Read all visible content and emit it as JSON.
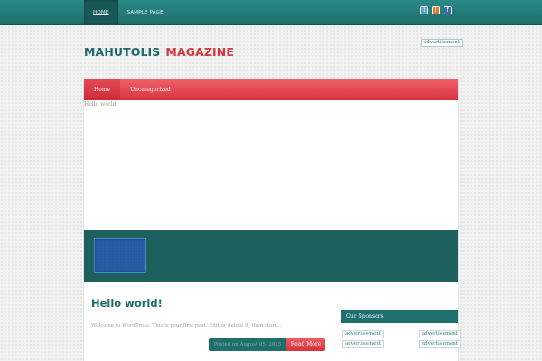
{
  "topnav": {
    "items": [
      "HOME",
      "SAMPLE PAGE"
    ]
  },
  "social": [
    {
      "icon": "twitter-icon",
      "glyph": "t",
      "color": "#4fa3c8"
    },
    {
      "icon": "rss-icon",
      "glyph": ")",
      "color": "#e07a2a"
    },
    {
      "icon": "facebook-icon",
      "glyph": "f",
      "color": "#3b6aa6"
    }
  ],
  "logo": {
    "part1": "MAHUTOLIS",
    "part2": "MAGAZINE"
  },
  "ad_top": "advertisement",
  "menu": {
    "items": [
      "Home",
      "Uncategorized"
    ]
  },
  "breadcrumb": "Hello world!",
  "post": {
    "title": "Hello world!",
    "excerpt": "Welcome to WordPress. This is your first post. Edit or delete it, then start...",
    "posted": "Posted on August 05, 2015",
    "read_more": "Read More"
  },
  "sidebar": {
    "heading": "Our Sponsors",
    "ads": [
      "advertisement",
      "advertisement",
      "advertisement",
      "advertisement"
    ]
  },
  "colors": {
    "teal": "#1f706c",
    "red": "#d8363f"
  }
}
